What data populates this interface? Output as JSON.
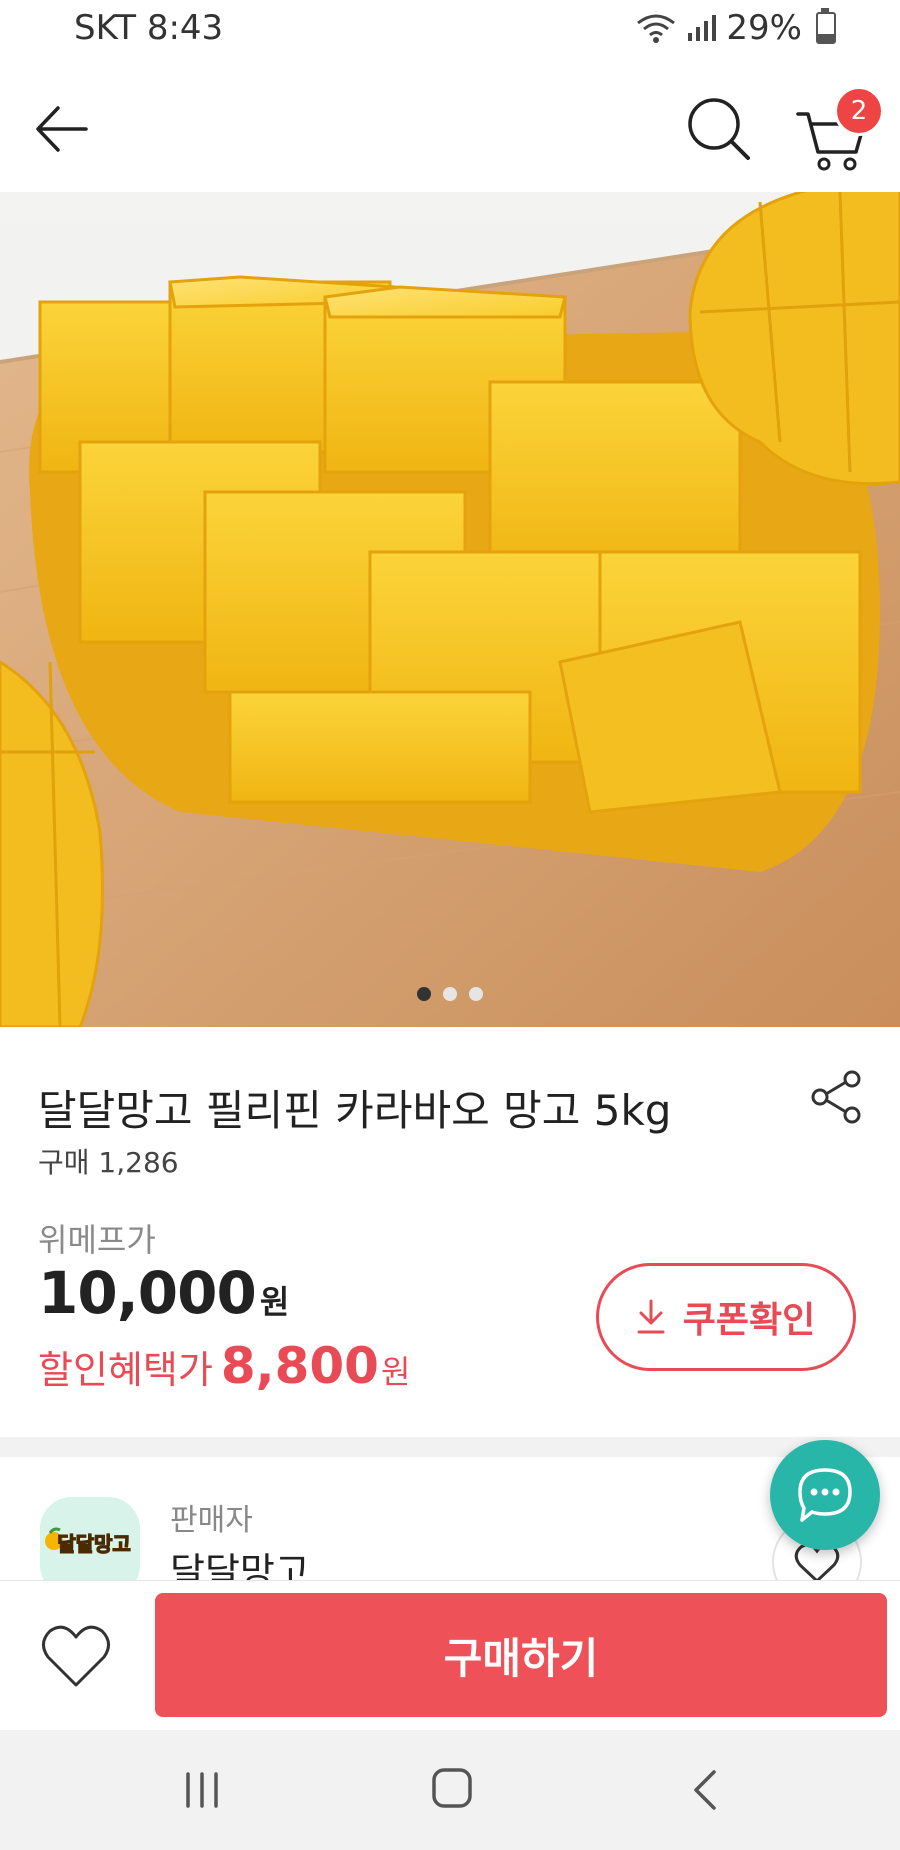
{
  "status_bar": {
    "carrier_time": "SKT 8:43",
    "battery": "29%",
    "battery_level": 0.29
  },
  "header": {
    "back_icon": "arrow-left-icon",
    "search_icon": "search-icon",
    "cart_icon": "cart-icon",
    "cart_count": "2"
  },
  "gallery": {
    "image": "mango-photo",
    "page_count": 3,
    "active_index": 0
  },
  "product": {
    "title": "달달망고 필리핀 카라바오 망고 5kg",
    "purchase_count": "구매 1,286",
    "original_price_label": "위메프가",
    "original_price": "10,000",
    "currency": "원",
    "sale_label": "할인혜택가",
    "sale_price": "8,800",
    "coupon_label": "쿠폰확인"
  },
  "seller": {
    "label": "판매자",
    "name": "달달망고",
    "logo_text": "달달망고"
  },
  "actions": {
    "buy_label": "구매하기"
  },
  "colors": {
    "accent": "#ee5157",
    "sale_red": "#e84b55",
    "chat_teal": "#27b6a8",
    "mango": "#f7c51a"
  }
}
